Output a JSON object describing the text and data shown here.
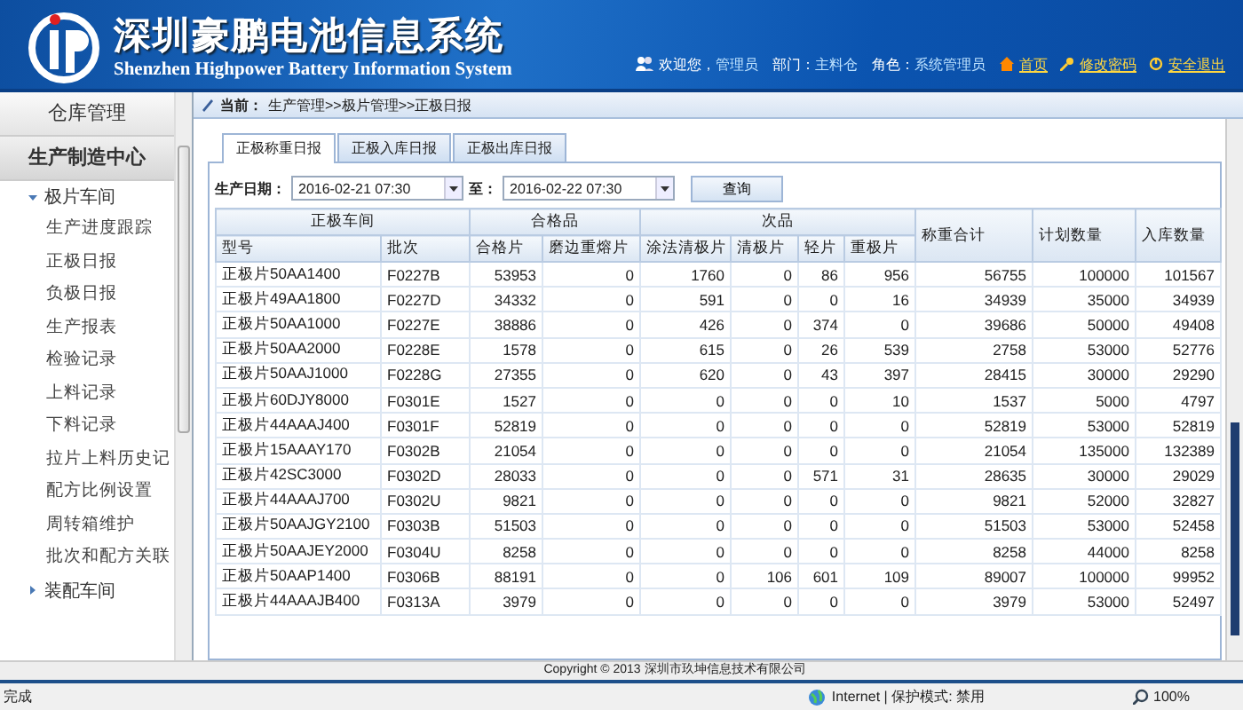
{
  "header": {
    "title": "深圳豪鹏电池信息系统",
    "subtitle": "Shenzhen Highpower Battery Information System",
    "welcome": "欢迎您，",
    "user": "管理员",
    "dept_label": "部门：",
    "dept": "主料仓",
    "role_label": "角色：",
    "role": "系统管理员",
    "links": [
      "首页",
      "修改密码",
      "安全退出"
    ]
  },
  "sidebar": {
    "sections": [
      {
        "label": "仓库管理",
        "selected": false
      },
      {
        "label": "生产制造中心",
        "selected": true
      }
    ],
    "tree": [
      {
        "label": "极片车间",
        "expanded": true,
        "children": [
          {
            "label": "生产进度跟踪"
          },
          {
            "label": "正极日报"
          },
          {
            "label": "负极日报"
          },
          {
            "label": "生产报表"
          },
          {
            "label": "检验记录"
          },
          {
            "label": "上料记录"
          },
          {
            "label": "下料记录"
          },
          {
            "label": "拉片上料历史记"
          },
          {
            "label": "配方比例设置"
          },
          {
            "label": "周转箱维护"
          },
          {
            "label": "批次和配方关联"
          }
        ]
      },
      {
        "label": "装配车间",
        "expanded": false
      }
    ]
  },
  "breadcrumb": {
    "label": "当前：",
    "path": "生产管理>>极片管理>>正极日报"
  },
  "tabs": [
    {
      "label": "正极称重日报",
      "selected": true
    },
    {
      "label": "正极入库日报",
      "selected": false
    },
    {
      "label": "正极出库日报",
      "selected": false
    }
  ],
  "filter": {
    "label": "生产日期：",
    "from": "2016-02-21 07:30",
    "to_label": "至：",
    "to": "2016-02-22 07:30",
    "button": "查询"
  },
  "table": {
    "groups": [
      {
        "label": "正极车间"
      },
      {
        "label": "合格品"
      },
      {
        "label": "次品"
      }
    ],
    "single_columns": [
      "称重合计",
      "计划数量",
      "入库数量"
    ],
    "columns": [
      "型号",
      "批次",
      "合格片",
      "磨边重熔片",
      "涂法清极片",
      "清极片",
      "轻片",
      "重极片"
    ],
    "rows": [
      [
        "正极片50AA1400",
        "F0227B",
        "53953",
        "0",
        "1760",
        "0",
        "86",
        "956",
        "56755",
        "100000",
        "101567"
      ],
      [
        "正极片49AA1800",
        "F0227D",
        "34332",
        "0",
        "591",
        "0",
        "0",
        "16",
        "34939",
        "35000",
        "34939"
      ],
      [
        "正极片50AA1000",
        "F0227E",
        "38886",
        "0",
        "426",
        "0",
        "374",
        "0",
        "39686",
        "50000",
        "49408"
      ],
      [
        "正极片50AA2000",
        "F0228E",
        "1578",
        "0",
        "615",
        "0",
        "26",
        "539",
        "2758",
        "53000",
        "52776"
      ],
      [
        "正极片50AAJ1000",
        "F0228G",
        "27355",
        "0",
        "620",
        "0",
        "43",
        "397",
        "28415",
        "30000",
        "29290"
      ],
      [
        "正极片60DJY8000",
        "F0301E",
        "1527",
        "0",
        "0",
        "0",
        "0",
        "10",
        "1537",
        "5000",
        "4797"
      ],
      [
        "正极片44AAAJ400",
        "F0301F",
        "52819",
        "0",
        "0",
        "0",
        "0",
        "0",
        "52819",
        "53000",
        "52819"
      ],
      [
        "正极片15AAAY170",
        "F0302B",
        "21054",
        "0",
        "0",
        "0",
        "0",
        "0",
        "21054",
        "135000",
        "132389"
      ],
      [
        "正极片42SC3000",
        "F0302D",
        "28033",
        "0",
        "0",
        "0",
        "571",
        "31",
        "28635",
        "30000",
        "29029"
      ],
      [
        "正极片44AAAJ700",
        "F0302U",
        "9821",
        "0",
        "0",
        "0",
        "0",
        "0",
        "9821",
        "52000",
        "32827"
      ],
      [
        "正极片50AAJGY2100",
        "F0303B",
        "51503",
        "0",
        "0",
        "0",
        "0",
        "0",
        "51503",
        "53000",
        "52458"
      ],
      [
        "正极片50AAJEY2000",
        "F0304U",
        "8258",
        "0",
        "0",
        "0",
        "0",
        "0",
        "8258",
        "44000",
        "8258"
      ],
      [
        "正极片50AAP1400",
        "F0306B",
        "88191",
        "0",
        "0",
        "106",
        "601",
        "109",
        "89007",
        "100000",
        "99952"
      ],
      [
        "正极片44AAAJB400",
        "F0313A",
        "3979",
        "0",
        "0",
        "0",
        "0",
        "0",
        "3979",
        "53000",
        "52497"
      ]
    ]
  },
  "footer": "Copyright © 2013 深圳市玖坤信息技术有限公司",
  "status_bar": {
    "text": "完成",
    "zone": "Internet | 保护模式: 禁用",
    "zoom": "100%"
  }
}
